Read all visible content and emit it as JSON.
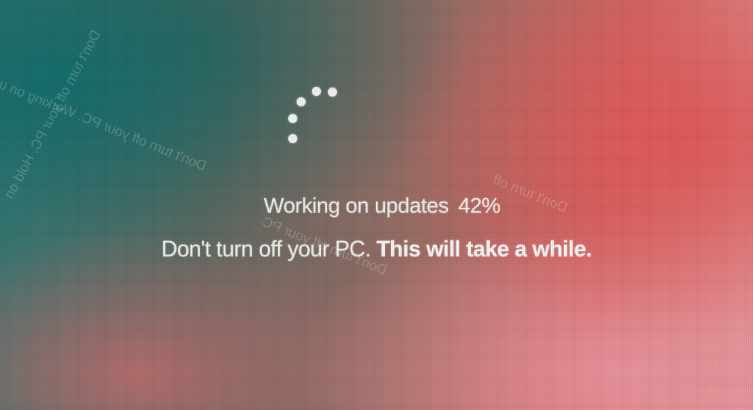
{
  "status": {
    "title": "Working on updates",
    "progress_text": "42%",
    "progress_percent": 42
  },
  "message": {
    "part1": "Don't turn off your PC.",
    "part2": "This will take a while."
  }
}
